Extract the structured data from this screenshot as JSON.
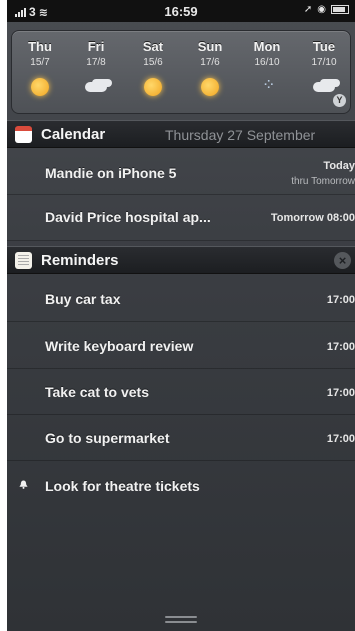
{
  "status_bar": {
    "carrier": "3",
    "time": "16:59"
  },
  "weather": {
    "days": [
      {
        "name": "Thu",
        "date": "15/7",
        "icon": "sun-icon"
      },
      {
        "name": "Fri",
        "date": "17/8",
        "icon": "cloud-icon"
      },
      {
        "name": "Sat",
        "date": "15/6",
        "icon": "sun-icon"
      },
      {
        "name": "Sun",
        "date": "17/6",
        "icon": "sun-icon"
      },
      {
        "name": "Mon",
        "date": "16/10",
        "icon": "rain-icon"
      },
      {
        "name": "Tue",
        "date": "17/10",
        "icon": "cloud-icon"
      }
    ],
    "badge": "Y"
  },
  "calendar": {
    "title": "Calendar",
    "date": "Thursday 27 September",
    "events": [
      {
        "title": "Mandie on iPhone 5",
        "time": "Today",
        "sub": "thru Tomorrow"
      },
      {
        "title": "David Price hospital ap...",
        "time": "Tomorrow 08:00"
      }
    ]
  },
  "reminders": {
    "title": "Reminders",
    "items": [
      {
        "title": "Buy car tax",
        "time": "17:00"
      },
      {
        "title": "Write keyboard review",
        "time": "17:00"
      },
      {
        "title": "Take cat to vets",
        "time": "17:00"
      },
      {
        "title": "Go to supermarket",
        "time": "17:00"
      },
      {
        "title": "Look for theatre tickets",
        "time": ""
      }
    ]
  },
  "colors": {
    "panel": "#3b3e43",
    "header": "#1c1e21",
    "calendar_accent": "#d94b3c",
    "sun": "#f1a522"
  }
}
